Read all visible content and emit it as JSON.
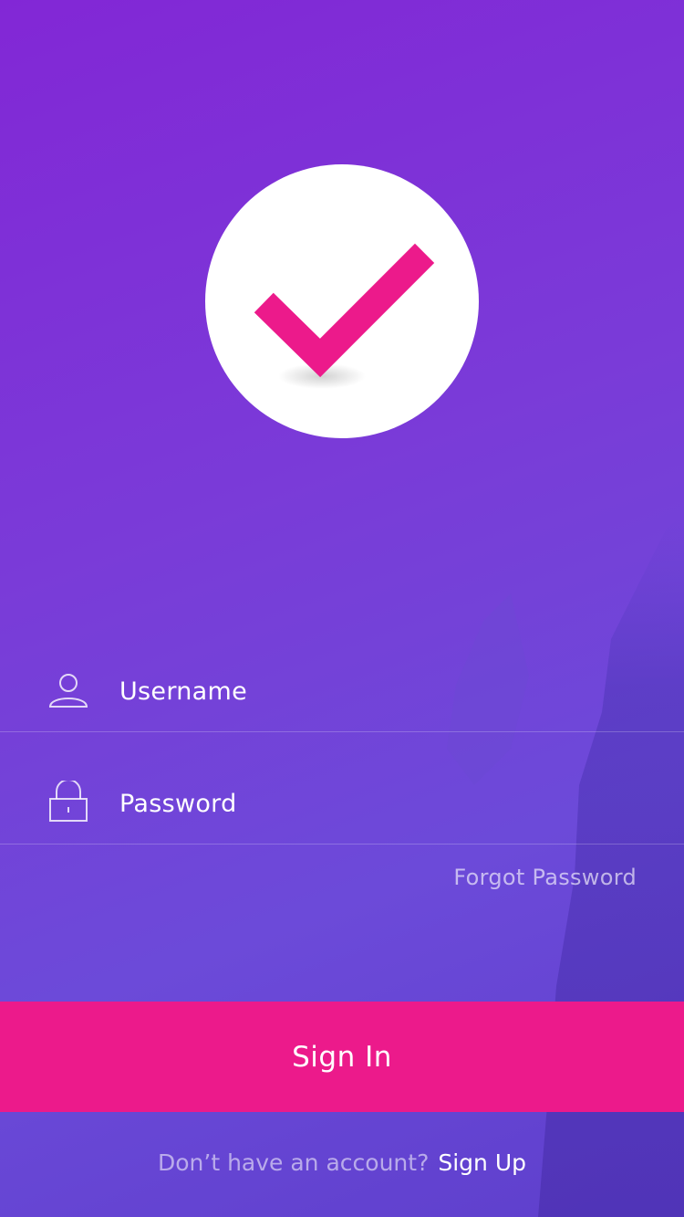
{
  "logo": {
    "icon": "check-icon",
    "circle_color": "#ffffff",
    "check_color": "#ec1a8b"
  },
  "form": {
    "username": {
      "icon": "user-icon",
      "placeholder": "Username"
    },
    "password": {
      "icon": "lock-icon",
      "placeholder": "Password"
    },
    "forgot_password": "Forgot Password"
  },
  "signin": {
    "label": "Sign In",
    "color": "#ec1a8b"
  },
  "signup": {
    "question": "Don’t have an account?",
    "link": "Sign Up"
  },
  "theme": {
    "gradient_start": "#8227d6",
    "gradient_end": "#5e3fcc"
  }
}
